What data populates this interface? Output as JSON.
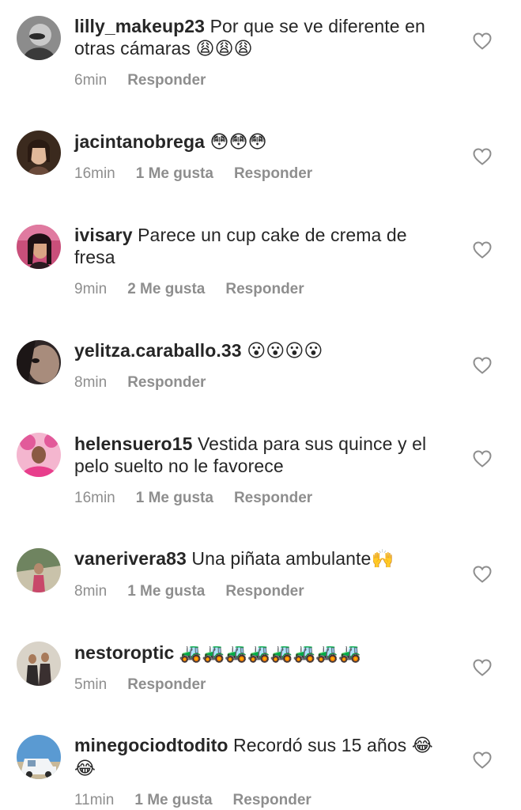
{
  "comments": [
    {
      "username": "lilly_makeup23",
      "text": "Por que se ve diferente en otras cámaras",
      "emoji": "😩😩😩",
      "time": "6min",
      "likes": "",
      "reply": "Responder",
      "avatar_colors": [
        "#3a3a3a",
        "#9a9a9a"
      ]
    },
    {
      "username": "jacintanobrega",
      "text": "",
      "emoji": "😳😳😳",
      "time": "16min",
      "likes": "1 Me gusta",
      "reply": "Responder",
      "avatar_colors": [
        "#4a3020",
        "#d7b49a"
      ]
    },
    {
      "username": "ivisary",
      "text": "Parece un cup cake de crema de fresa",
      "emoji": "",
      "time": "9min",
      "likes": "2 Me gusta",
      "reply": "Responder",
      "avatar_colors": [
        "#c25a7a",
        "#2b1a20"
      ]
    },
    {
      "username": "yelitza.caraballo.33",
      "text": "",
      "emoji": "😮😮😮😮",
      "time": "8min",
      "likes": "",
      "reply": "Responder",
      "avatar_colors": [
        "#3b3030",
        "#b09080"
      ]
    },
    {
      "username": "helensuero15",
      "text": "Vestida para sus quince y el pelo suelto no le favorece",
      "emoji": "",
      "time": "16min",
      "likes": "1 Me gusta",
      "reply": "Responder",
      "avatar_colors": [
        "#e96aa5",
        "#f6c0d8"
      ]
    },
    {
      "username": "vanerivera83",
      "text": "Una piñata ambulante",
      "emoji": "🙌",
      "time": "8min",
      "likes": "1 Me gusta",
      "reply": "Responder",
      "avatar_colors": [
        "#7a8a60",
        "#c0b9a0"
      ]
    },
    {
      "username": "nestoroptic",
      "text": "",
      "emoji": "🚜🚜🚜🚜🚜🚜🚜🚜",
      "time": "5min",
      "likes": "",
      "reply": "Responder",
      "avatar_colors": [
        "#5a4a3a",
        "#d8d2c8"
      ]
    },
    {
      "username": "minegociodtodito",
      "text": "Recordó sus 15 años",
      "emoji": "😂😂",
      "time": "11min",
      "likes": "1 Me gusta",
      "reply": "Responder",
      "avatar_colors": [
        "#4a8cc8",
        "#e8eef4"
      ]
    }
  ],
  "icons": {
    "like": "heart-outline-icon"
  },
  "colors": {
    "text": "#262626",
    "meta": "#8e8e8e",
    "background": "#ffffff"
  }
}
